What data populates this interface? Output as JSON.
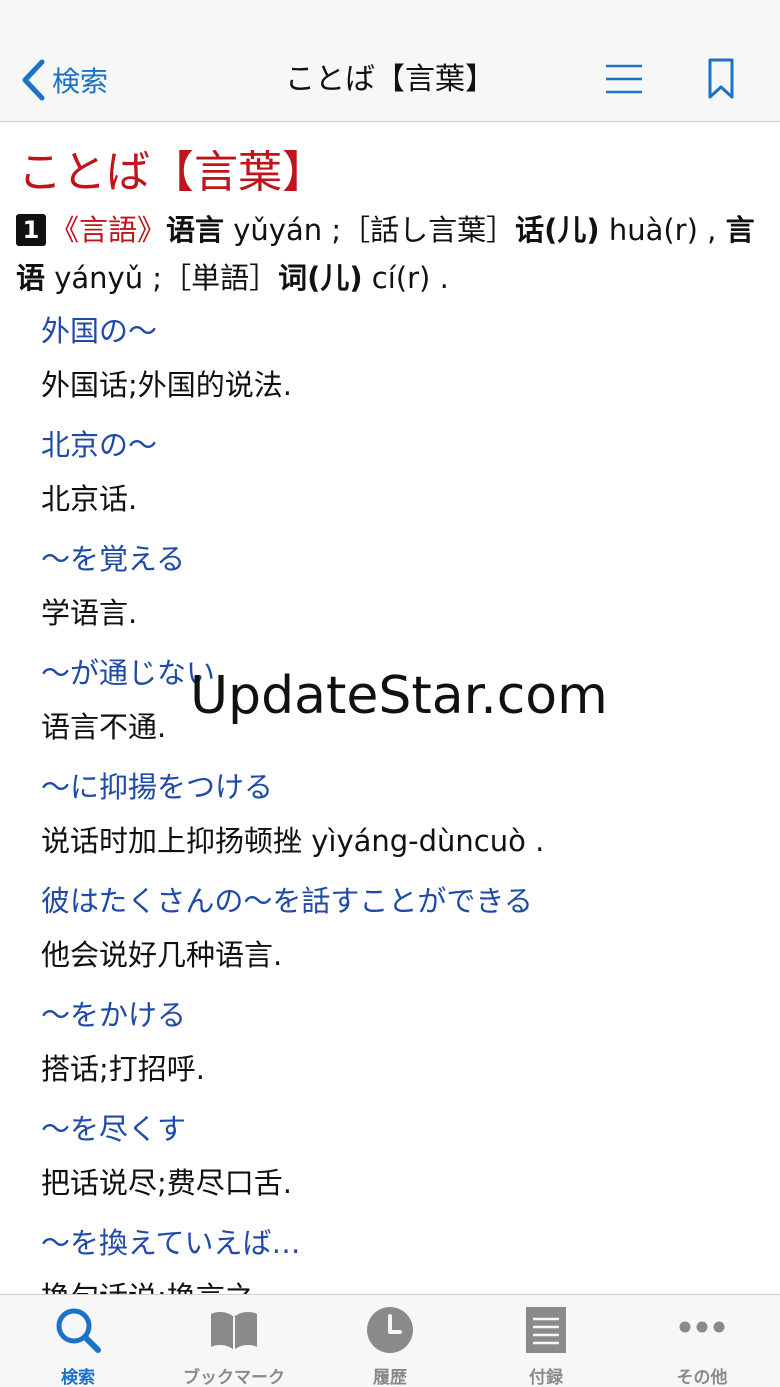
{
  "navbar": {
    "back_label": "検索",
    "title": "ことば【言葉】",
    "icons": {
      "back": "chevron-left-icon",
      "menu": "list-icon",
      "bookmark": "bookmark-icon"
    }
  },
  "entry": {
    "headword": "ことば【言葉】",
    "sense_number": "1",
    "sense_label": "《言語》",
    "line1_bold1": "语言",
    "line1_text1": " yǔyán ;［話し言葉］",
    "line1_bold2": "话(儿)",
    "line1_text2": " huà(r) , ",
    "line1_bold3": "言语",
    "line1_text3": " yányǔ ;［単語］",
    "line1_bold4": "词(儿)",
    "line1_text4": " cí(r) ."
  },
  "examples": [
    {
      "jp": "外国の〜",
      "cn": "外国话;外国的说法."
    },
    {
      "jp": "北京の〜",
      "cn": "北京话."
    },
    {
      "jp": "〜を覚える",
      "cn": "学语言."
    },
    {
      "jp": "〜が通じない",
      "cn": "语言不通."
    },
    {
      "jp": "〜に抑揚をつける",
      "cn": "说话时加上抑扬顿挫 yìyáng-dùncuò ."
    },
    {
      "jp": "彼はたくさんの〜を話すことができる",
      "cn": "他会说好几种语言."
    },
    {
      "jp": "〜をかける",
      "cn": "搭话;打招呼."
    },
    {
      "jp": "〜を尽くす",
      "cn": "把话说尽;费尽口舌."
    },
    {
      "jp": "〜を換えていえば…",
      "cn": "换句话说;换言之."
    }
  ],
  "watermark": "UpdateStar.com",
  "tabbar": {
    "tabs": [
      {
        "label": "検索",
        "icon": "search-icon",
        "active": true
      },
      {
        "label": "ブックマーク",
        "icon": "book-icon",
        "active": false
      },
      {
        "label": "履歴",
        "icon": "clock-icon",
        "active": false
      },
      {
        "label": "付録",
        "icon": "document-icon",
        "active": false
      },
      {
        "label": "その他",
        "icon": "more-icon",
        "active": false
      }
    ]
  },
  "colors": {
    "accent_blue": "#1a73c9",
    "headword_red": "#c0141c",
    "example_blue": "#1f4aa8",
    "inactive_gray": "#8a8a8a"
  }
}
